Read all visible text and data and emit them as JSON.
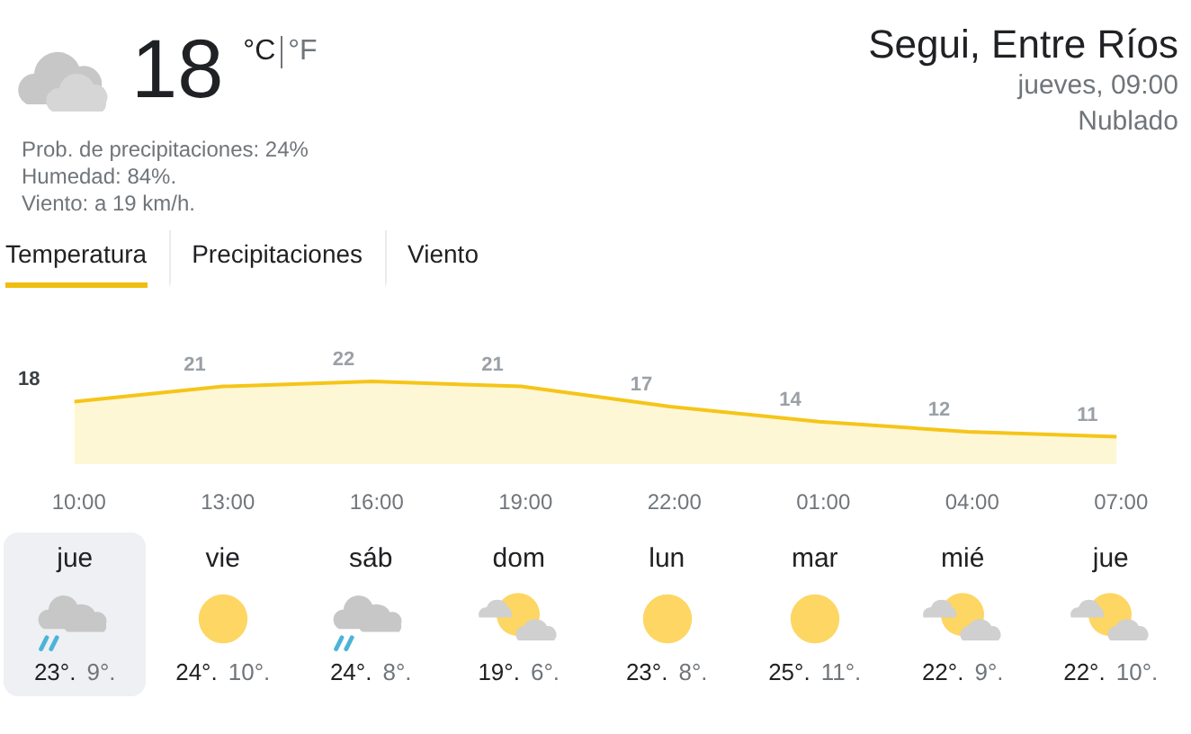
{
  "current": {
    "kind": "cloudy",
    "temperature": "18",
    "units": [
      {
        "label": "°C",
        "selected": true
      },
      {
        "label": "°F",
        "selected": false
      }
    ],
    "details": [
      "Prob. de precipitaciones: 24%",
      "Humedad: 84%.",
      "Viento: a 19 km/h."
    ]
  },
  "location": {
    "name": "Segui, Entre Ríos",
    "time": "jueves, 09:00",
    "condition": "Nublado"
  },
  "tabs": [
    {
      "label": "Temperatura",
      "selected": true
    },
    {
      "label": "Precipitaciones",
      "selected": false
    },
    {
      "label": "Viento",
      "selected": false
    }
  ],
  "hourly": {
    "chart_data": {
      "type": "area",
      "categories": [
        "10:00",
        "13:00",
        "16:00",
        "19:00",
        "22:00",
        "01:00",
        "04:00",
        "07:00"
      ],
      "values": [
        18,
        21,
        22,
        21,
        17,
        14,
        12,
        11
      ],
      "data_labels": true
    }
  },
  "days": [
    {
      "day": "jue",
      "kind": "rain",
      "high": "23°.",
      "low": "9°.",
      "selected": true
    },
    {
      "day": "vie",
      "kind": "sunny",
      "high": "24°.",
      "low": "10°.",
      "selected": false
    },
    {
      "day": "sáb",
      "kind": "rain",
      "high": "24°.",
      "low": "8°.",
      "selected": false
    },
    {
      "day": "dom",
      "kind": "partly_cloudy",
      "high": "19°.",
      "low": "6°.",
      "selected": false
    },
    {
      "day": "lun",
      "kind": "sunny",
      "high": "23°.",
      "low": "8°.",
      "selected": false
    },
    {
      "day": "mar",
      "kind": "sunny",
      "high": "25°.",
      "low": "11°.",
      "selected": false
    },
    {
      "day": "mié",
      "kind": "partly_cloudy",
      "high": "22°.",
      "low": "9°.",
      "selected": false
    },
    {
      "day": "jue",
      "kind": "partly_cloudy",
      "high": "22°.",
      "low": "10°.",
      "selected": false
    }
  ]
}
